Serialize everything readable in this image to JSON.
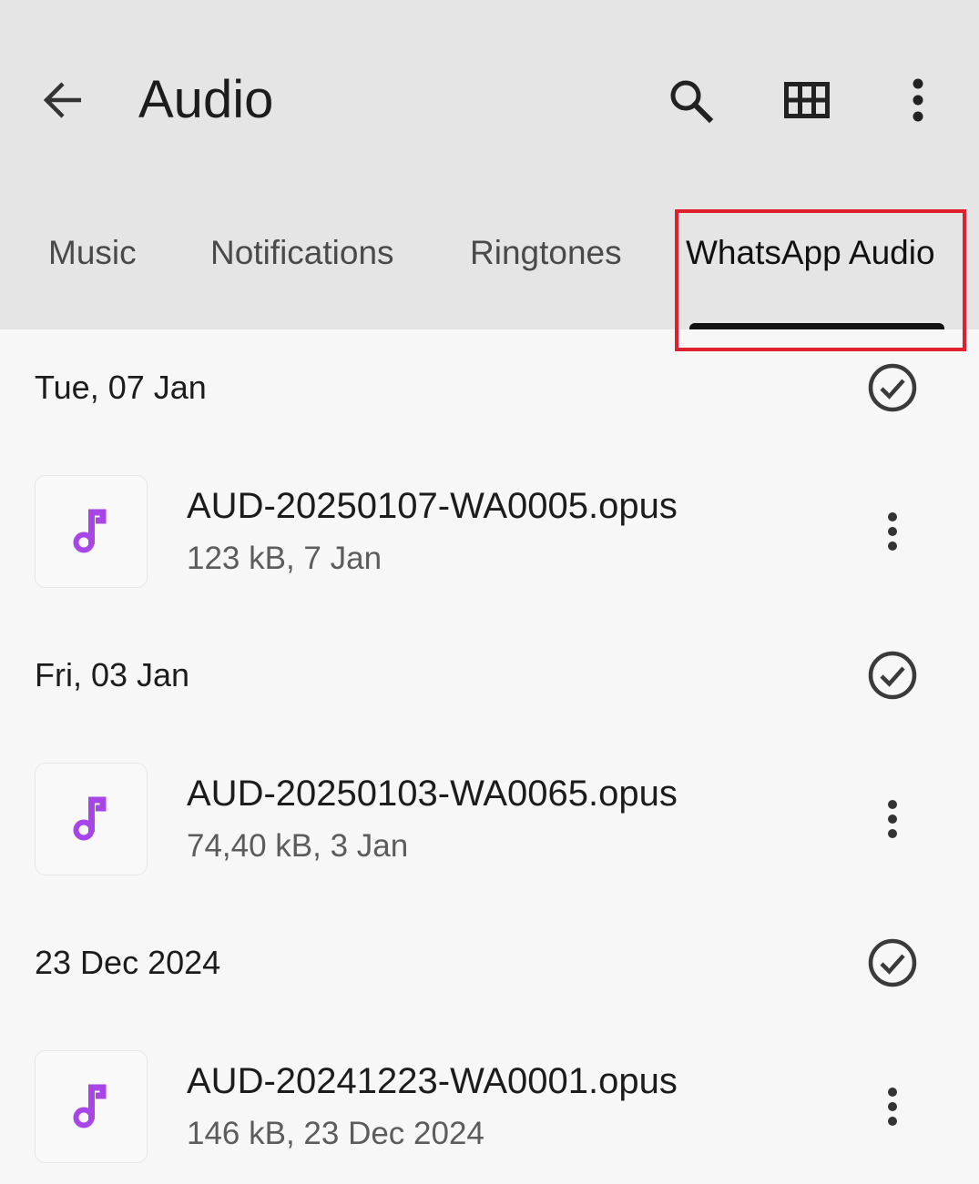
{
  "app_bar": {
    "title": "Audio",
    "icons": [
      "back-arrow-icon",
      "search-icon",
      "grid-view-icon",
      "more-vert-icon"
    ]
  },
  "tabs": [
    {
      "label": "Music",
      "selected": false
    },
    {
      "label": "Notifications",
      "selected": false
    },
    {
      "label": "Ringtones",
      "selected": false
    },
    {
      "label": "WhatsApp Audio",
      "selected": true
    }
  ],
  "colors": {
    "header_bg": "#e5e5e5",
    "content_bg": "#f7f7f7",
    "music_note": "#a745e8",
    "highlight_border": "#e0202d",
    "tab_indicator": "#111111"
  },
  "sections": [
    {
      "date": "Tue, 07 Jan",
      "files": [
        {
          "name": "AUD-20250107-WA0005.opus",
          "meta": "123 kB, 7 Jan"
        }
      ]
    },
    {
      "date": "Fri, 03 Jan",
      "files": [
        {
          "name": "AUD-20250103-WA0065.opus",
          "meta": "74,40 kB, 3 Jan"
        }
      ]
    },
    {
      "date": "23 Dec 2024",
      "files": [
        {
          "name": "AUD-20241223-WA0001.opus",
          "meta": "146 kB, 23 Dec 2024"
        }
      ]
    }
  ]
}
